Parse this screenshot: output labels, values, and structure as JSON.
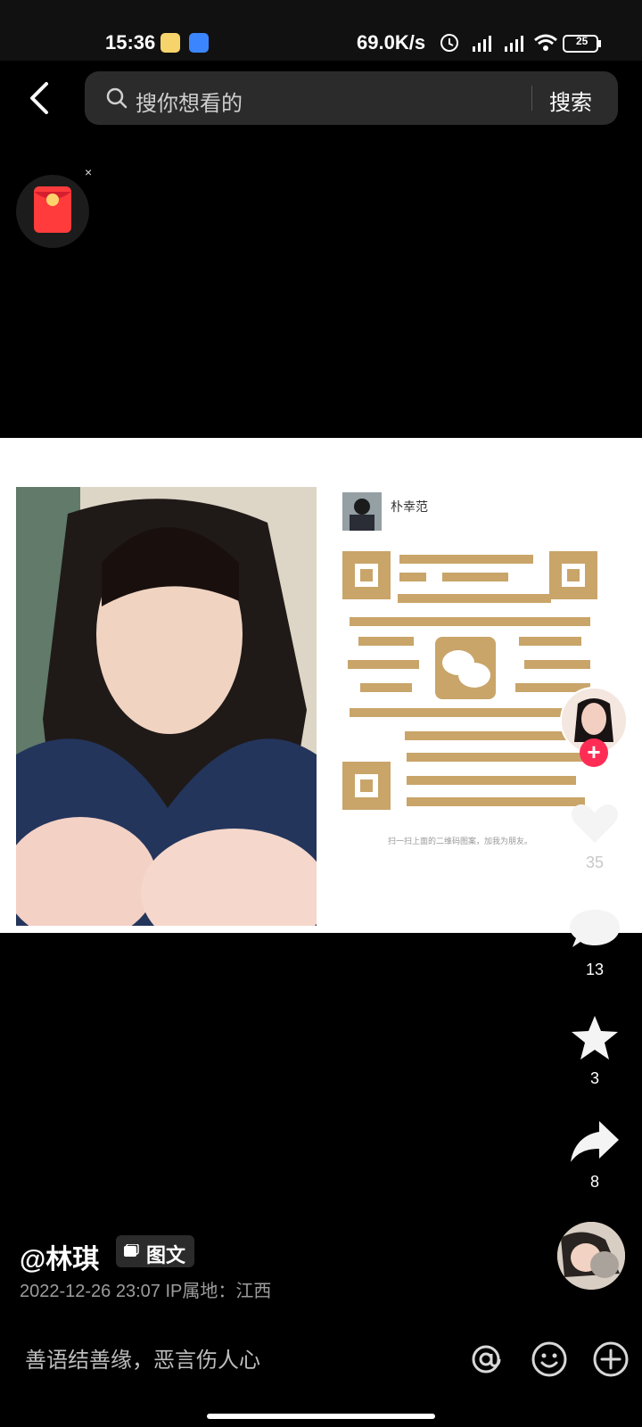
{
  "status_bar": {
    "time": "15:36",
    "network_speed": "69.0K/s",
    "battery": "25",
    "icons": [
      "app-notification-icon",
      "location-app-icon",
      "alarm-icon",
      "hd-signal-icon",
      "hd-signal-icon",
      "wifi-icon",
      "battery-icon"
    ]
  },
  "search": {
    "placeholder": "搜你想看的",
    "button_label": "搜索"
  },
  "post": {
    "profile_name": "朴幸范",
    "qr_caption": "扫一扫上面的二维码图案，加我为朋友。"
  },
  "actions": {
    "likes": "35",
    "comments": "13",
    "favorites": "3",
    "shares": "8"
  },
  "author": {
    "handle": "@林琪",
    "type_label": "图文",
    "meta": "2022-12-26 23:07  IP属地：江西"
  },
  "comment_bar": {
    "placeholder": "善语结善缘，恶言伤人心"
  },
  "colors": {
    "accent": "#ff2d55",
    "qr_gold": "#c9a56a",
    "background": "#000000"
  }
}
